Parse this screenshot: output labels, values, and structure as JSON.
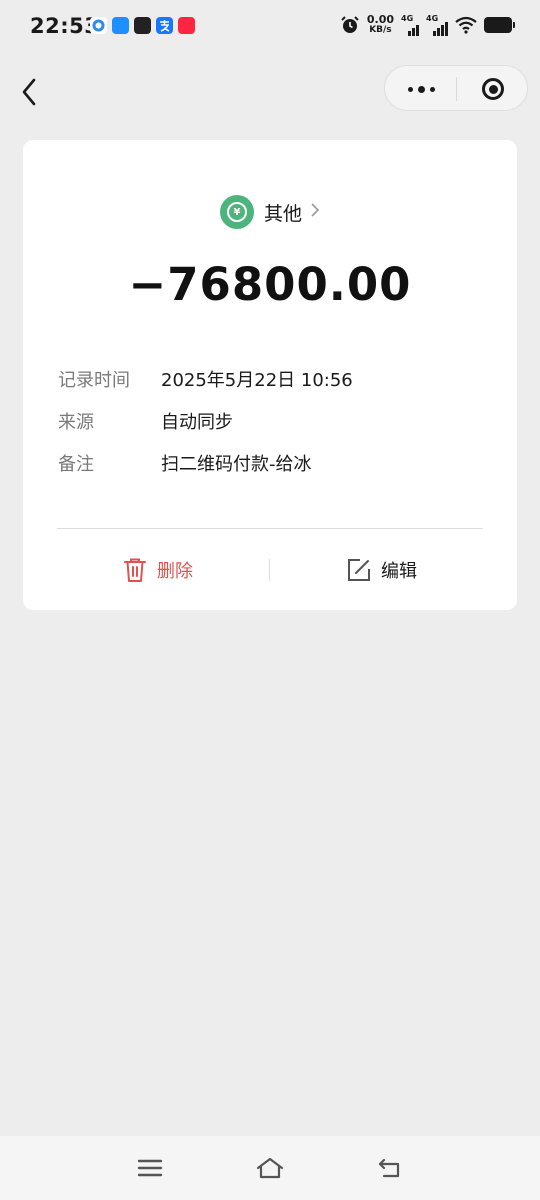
{
  "status_bar": {
    "time": "22:53",
    "net_speed_value": "0.00",
    "net_speed_unit": "KB/s",
    "signal1_label": "4G",
    "signal2_label": "4G",
    "app_icons": [
      "qq-browser-icon",
      "notification-app-icon",
      "news-app-icon",
      "alipay-icon",
      "xiaohongshu-icon"
    ]
  },
  "nav": {
    "back_icon": "chevron-left-icon",
    "more_icon": "more-dots-icon",
    "close_icon": "target-circle-icon"
  },
  "record": {
    "category_label": "其他",
    "category_icon": "yuan-coin-icon",
    "category_color": "#4cb47c",
    "amount": "−76800.00",
    "fields": [
      {
        "key": "记录时间",
        "value": "2025年5月22日 10:56"
      },
      {
        "key": "来源",
        "value": "自动同步"
      },
      {
        "key": "备注",
        "value": "扫二维码付款-给冰"
      }
    ]
  },
  "actions": {
    "delete_label": "删除",
    "delete_color": "#e0524f",
    "edit_label": "编辑"
  },
  "system_nav": {
    "menu_icon": "menu-icon",
    "home_icon": "home-icon",
    "back_icon": "back-arrow-icon"
  }
}
